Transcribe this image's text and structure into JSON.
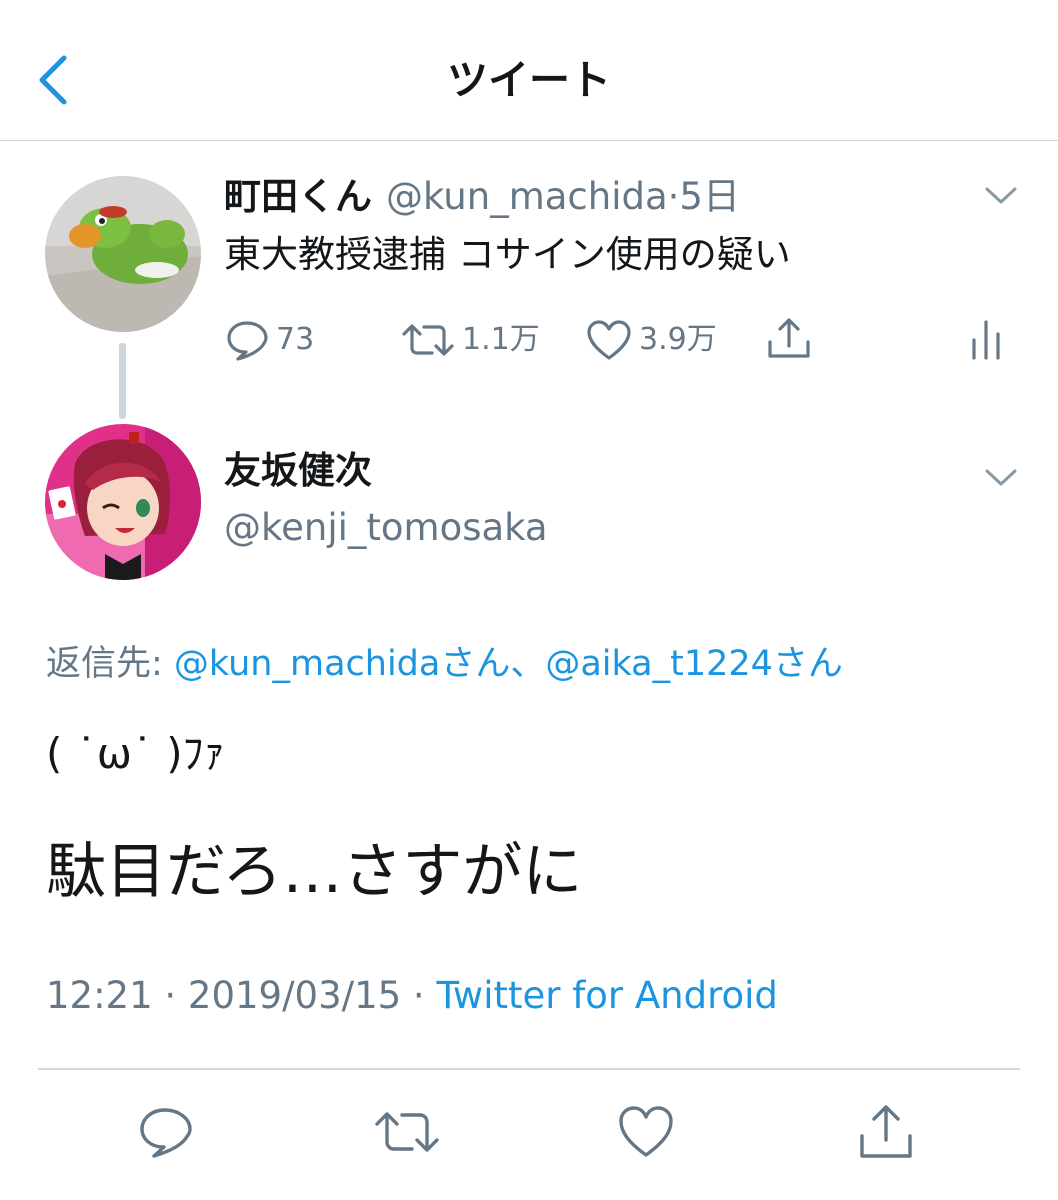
{
  "header": {
    "title": "ツイート"
  },
  "parent_tweet": {
    "name": "町田くん",
    "handle": "@kun_machida",
    "separator": "·",
    "time": "5日",
    "text": "東大教授逮捕 コサイン使用の疑い",
    "replies": "73",
    "retweets": "1.1万",
    "likes": "3.9万"
  },
  "reply_tweet": {
    "name": "友坂健次",
    "handle": "@kenji_tomosaka",
    "reply_to_prefix": "返信先: ",
    "reply_to_links": "@kun_machidaさん、@aika_t1224さん",
    "line1": "( ˙ω˙ )ﾌｧ",
    "line2": "駄目だろ…さすがに",
    "timestamp": "12:21 · 2019/03/15 · ",
    "source": "Twitter for Android"
  },
  "icons": {
    "back": "chevron-left-icon",
    "more": "chevron-down-icon",
    "reply": "speech-bubble-icon",
    "retweet": "retweet-arrows-icon",
    "like": "heart-icon",
    "share": "share-upload-icon",
    "analytics": "bar-chart-icon"
  },
  "colors": {
    "accent": "#1b95e0",
    "secondary_text": "#657786",
    "primary_text": "#14171a",
    "icon": "#657786"
  }
}
